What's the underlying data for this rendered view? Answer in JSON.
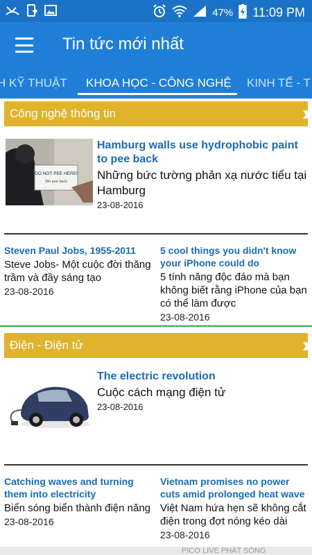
{
  "status_bar": {
    "battery": "47%",
    "time": "11:09 PM"
  },
  "app_bar": {
    "title": "Tin tức mới nhất"
  },
  "tabs": [
    {
      "label": "H KỸ THUẬT",
      "active": false
    },
    {
      "label": "KHOA HỌC - CÔNG NGHỆ",
      "active": true
    },
    {
      "label": "KINH TẾ - T",
      "active": false
    }
  ],
  "sections": [
    {
      "title": "Công nghệ thông tin",
      "featured": {
        "title": "Hamburg walls use hydrophobic paint to pee back",
        "subtitle": "Những bức tường phản xạ nước tiểu tại Hamburg",
        "date": "23-08-2016",
        "image_sign_line1": "DO NOT PEE HERE!",
        "image_sign_line2": "We pee back"
      },
      "cards": [
        {
          "title": "Steven Paul Jobs, 1955-2011",
          "subtitle": "Steve Jobs- Một cuộc đời thăng trầm và đầy sáng tạo",
          "date": "23-08-2016"
        },
        {
          "title": "5 cool things you didn't know your iPhone could do",
          "subtitle": "5 tính năng độc đáo mà bạn không biết rằng iPhone của bạn có thể làm được",
          "date": "23-08-2016"
        }
      ]
    },
    {
      "title": "Điện - Điện tử",
      "featured": {
        "title": "The electric revolution",
        "subtitle": "Cuộc cách mạng điện tử",
        "date": "23-08-2016"
      },
      "cards": [
        {
          "title": "Catching waves and turning them into electricity",
          "subtitle": "Biển sóng biển thành điện năng",
          "date": "23-08-2016"
        },
        {
          "title": "Vietnam promises no power cuts amid prolonged heat wave",
          "subtitle": "Việt Nam hứa hẹn sẽ không cắt điện trong đợt nóng kéo dài",
          "date": "23-08-2016"
        }
      ]
    }
  ],
  "ad": {
    "text": "PICO LIVE PHÁT SÓNG"
  },
  "colors": {
    "status_bar": "#1a73c6",
    "app_bar": "#1f7fd8",
    "section_header": "#e0b32c",
    "headline": "#1a6bb5",
    "separator_green": "#39a845"
  }
}
